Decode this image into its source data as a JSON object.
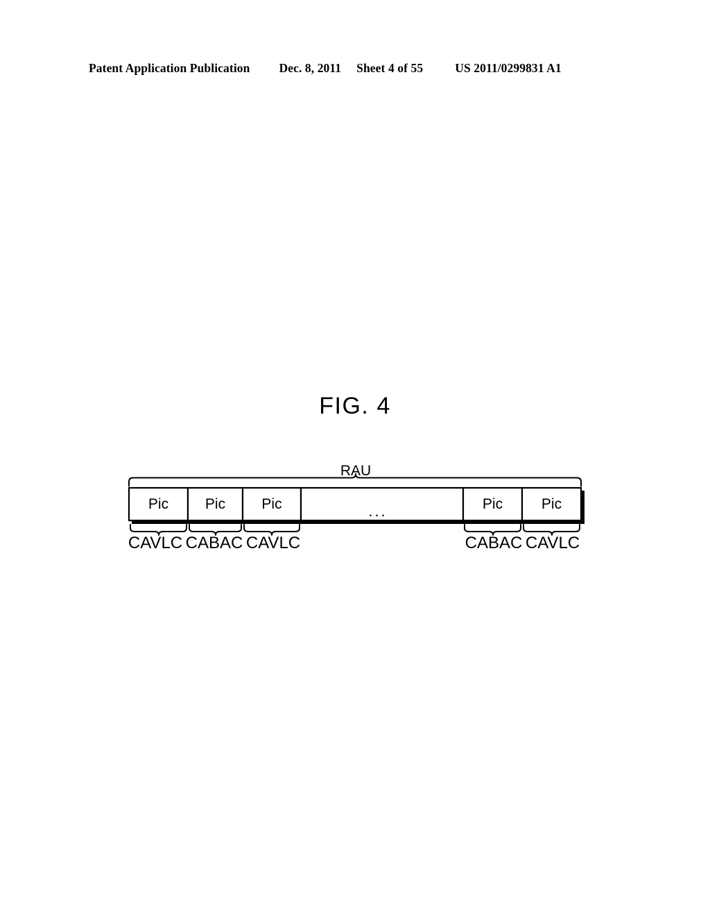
{
  "header": {
    "publication": "Patent Application Publication",
    "date": "Dec. 8, 2011",
    "sheet": "Sheet 4 of 55",
    "patent_number": "US 2011/0299831 A1"
  },
  "figure": {
    "title": "FIG. 4",
    "top_label": "RAU",
    "ellipsis": "...",
    "cells": [
      {
        "label": "Pic",
        "coding": "CAVLC"
      },
      {
        "label": "Pic",
        "coding": "CABAC"
      },
      {
        "label": "Pic",
        "coding": "CAVLC"
      },
      {
        "label": "",
        "coding": ""
      },
      {
        "label": "Pic",
        "coding": "CABAC"
      },
      {
        "label": "Pic",
        "coding": "CAVLC"
      }
    ],
    "bottom_labels": [
      "CAVLC",
      "CABAC",
      "CAVLC",
      "CABAC",
      "CAVLC"
    ],
    "colors": {
      "ink": "#000000",
      "paper": "#ffffff"
    }
  }
}
